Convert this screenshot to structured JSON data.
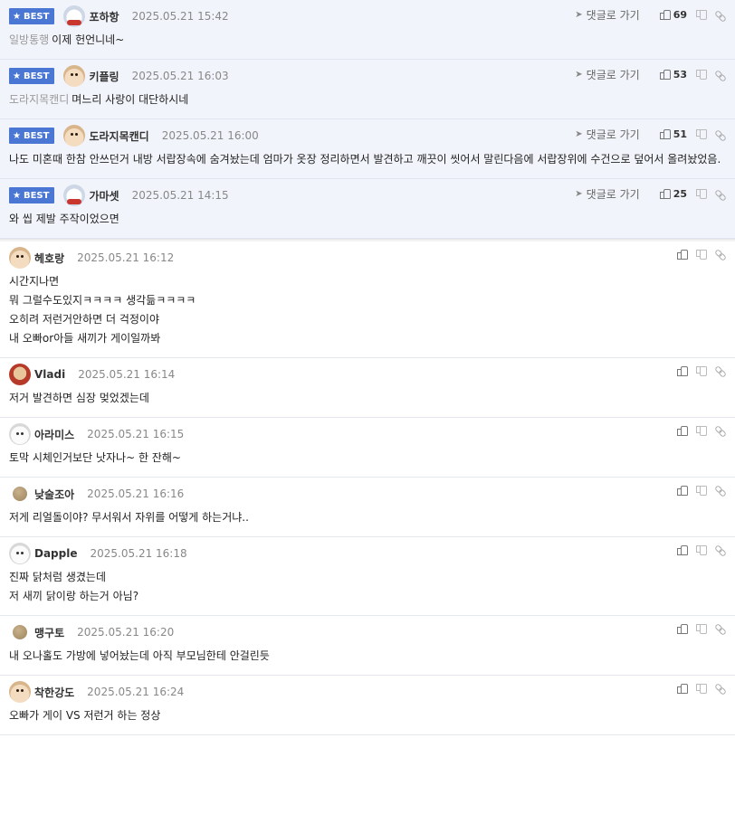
{
  "labels": {
    "best": "BEST",
    "goto": "댓글로 가기"
  },
  "best_comments": [
    {
      "avatar": "bear-icon",
      "nick": "포하항",
      "date": "2025.05.21 15:42",
      "category": "일방통행",
      "text": "이제 헌언니네~",
      "likes": "69"
    },
    {
      "avatar": "dog-icon",
      "nick": "키플링",
      "date": "2025.05.21 16:03",
      "category": "도라지목캔디",
      "text": "며느리 사랑이 대단하시네",
      "likes": "53"
    },
    {
      "avatar": "dog-icon",
      "nick": "도라지목캔디",
      "date": "2025.05.21 16:00",
      "category": "",
      "text": "나도 미혼때 한참 안쓰던거 내방 서랍장속에 숨겨놨는데 엄마가 옷장 정리하면서 발견하고 깨끗이 씻어서 말린다음에 서랍장위에 수건으로 덮어서 올려놨었음.",
      "likes": "51"
    },
    {
      "avatar": "bear-icon",
      "nick": "가마셋",
      "date": "2025.05.21 14:15",
      "category": "",
      "text": "와 씹 제발 주작이었으면",
      "likes": "25"
    }
  ],
  "comments": [
    {
      "avatar": "dog-icon",
      "nick": "헤호랑",
      "date": "2025.05.21 16:12",
      "text": "시간지나면\n뭐 그럴수도있지ㅋㅋㅋㅋ 생각듦ㅋㅋㅋㅋ\n오히려 저런거안하면 더 걱정이야\n내 오빠or아들 새끼가 게이일까봐"
    },
    {
      "avatar": "red-dog-icon",
      "nick": "Vladi",
      "date": "2025.05.21 16:14",
      "text": "저거 발견하면 심장 멎었겠는데"
    },
    {
      "avatar": "white-dog-icon",
      "nick": "아라미스",
      "date": "2025.05.21 16:15",
      "text": "토막 시체인거보단 낫자나~ 한 잔해~"
    },
    {
      "avatar": "ball-icon",
      "nick": "낮술조아",
      "date": "2025.05.21 16:16",
      "text": "저게 리얼돌이야? 무서워서 자위를 어떻게 하는거냐.."
    },
    {
      "avatar": "white-dog-icon",
      "nick": "Dapple",
      "date": "2025.05.21 16:18",
      "text": "진짜 닭처럼 생겼는데\n저 새끼 닭이랑 하는거 아님?"
    },
    {
      "avatar": "ball-icon",
      "nick": "맹구토",
      "date": "2025.05.21 16:20",
      "text": "내 오나홀도 가방에 넣어놨는데 아직 부모님한테 안걸린듯"
    },
    {
      "avatar": "dog-icon",
      "nick": "착한강도",
      "date": "2025.05.21 16:24",
      "text": "오빠가 게이 VS 저런거 하는 정상"
    }
  ]
}
